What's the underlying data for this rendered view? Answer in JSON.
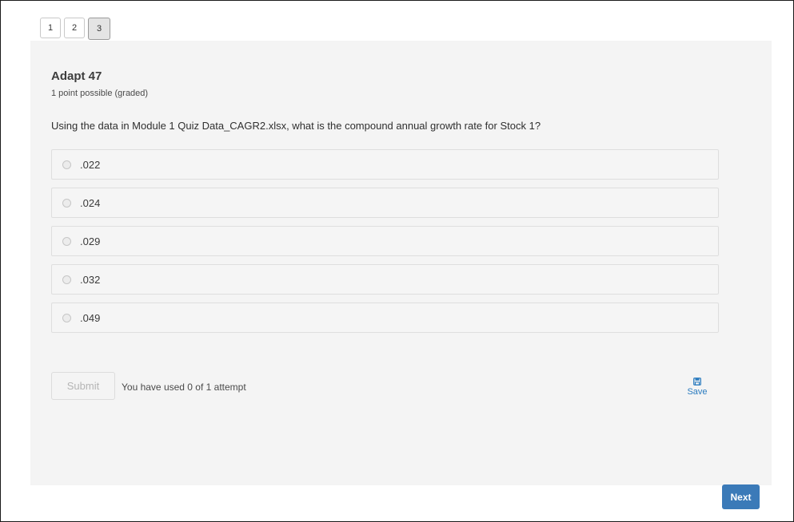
{
  "tabs": [
    "1",
    "2",
    "3"
  ],
  "active_tab": "3",
  "problem": {
    "title": "Adapt 47",
    "points": "1 point possible (graded)",
    "question": "Using the data in Module 1 Quiz Data_CAGR2.xlsx, what is the compound annual growth rate for Stock 1?",
    "options": [
      ".022",
      ".024",
      ".029",
      ".032",
      ".049"
    ]
  },
  "actions": {
    "submit_label": "Submit",
    "attempts_text": "You have used 0 of 1 attempt",
    "save_label": "Save",
    "save_icon": "floppy-disk-icon",
    "next_label": "Next"
  },
  "colors": {
    "panel_bg": "#f4f4f4",
    "accent_link": "#2a7bbf",
    "next_button": "#3b7ab8"
  }
}
